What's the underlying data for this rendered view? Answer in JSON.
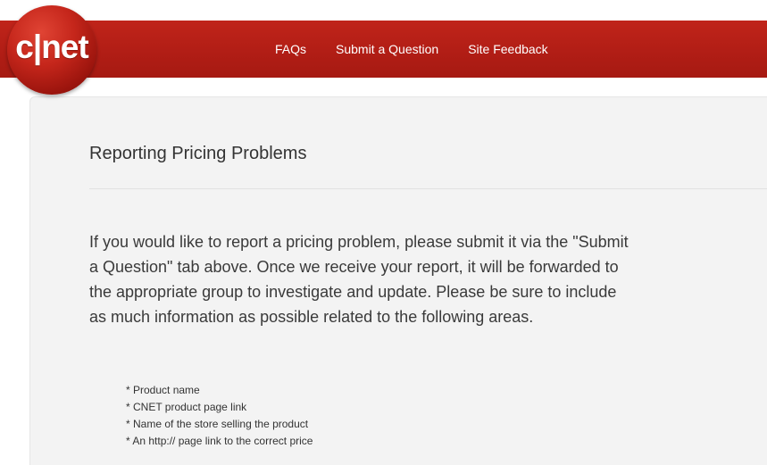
{
  "brand": {
    "logo_text": "c|net",
    "colors": {
      "header_red": "#b01d15",
      "panel_bg": "#f3f3f3",
      "text": "#333333"
    }
  },
  "nav": {
    "items": [
      {
        "label": "FAQs"
      },
      {
        "label": "Submit a Question"
      },
      {
        "label": "Site Feedback"
      }
    ]
  },
  "content": {
    "title": "Reporting Pricing Problems",
    "intro_lines": [
      "If you would like to report a pricing problem, please submit it via the \"Submit",
      "a Question\" tab above. Once we receive your report, it will be forwarded to",
      "the appropriate group to investigate and update. Please be sure to include",
      "as much information as possible related to the following areas."
    ],
    "list_items": [
      "* Product name",
      "* CNET product page link",
      "* Name of the store selling the product",
      "* An http:// page link to the correct price"
    ]
  }
}
